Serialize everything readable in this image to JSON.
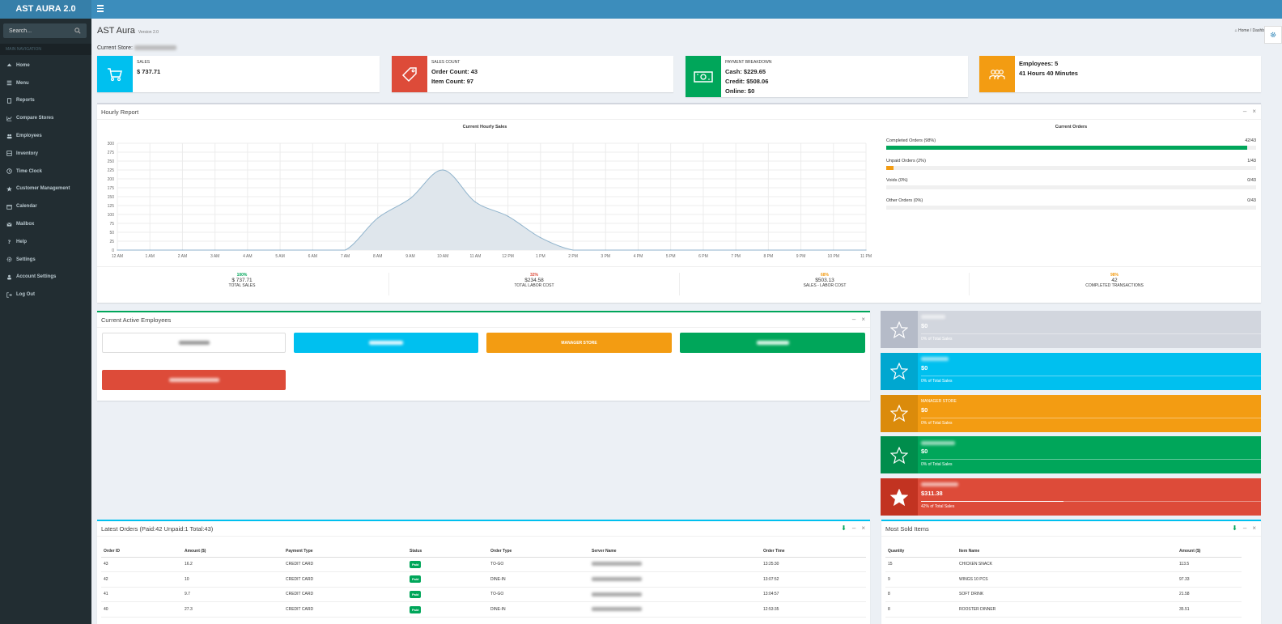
{
  "app": {
    "logo": "AST AURA 2.0"
  },
  "sidebar": {
    "search_placeholder": "Search...",
    "header": "MAIN NAVIGATION",
    "items": [
      {
        "label": "Home",
        "icon": "dashboard-icon"
      },
      {
        "label": "Menu",
        "icon": "menu-list-icon"
      },
      {
        "label": "Reports",
        "icon": "reports-icon"
      },
      {
        "label": "Compare Stores",
        "icon": "chart-icon"
      },
      {
        "label": "Employees",
        "icon": "users-icon"
      },
      {
        "label": "Inventory",
        "icon": "inventory-icon"
      },
      {
        "label": "Time Clock",
        "icon": "clock-icon"
      },
      {
        "label": "Customer Management",
        "icon": "star-icon"
      },
      {
        "label": "Calendar",
        "icon": "calendar-icon"
      },
      {
        "label": "Mailbox",
        "icon": "envelope-icon"
      },
      {
        "label": "Help",
        "icon": "question-icon"
      },
      {
        "label": "Settings",
        "icon": "gear-icon"
      },
      {
        "label": "Account Settings",
        "icon": "user-icon"
      },
      {
        "label": "Log Out",
        "icon": "logout-icon"
      }
    ]
  },
  "header": {
    "title": "AST Aura",
    "version": "Version 2.0",
    "breadcrumb_home": "Home",
    "breadcrumb_current": "Dashb",
    "current_store_label": "Current Store:"
  },
  "info_boxes": {
    "sales": {
      "label": "SALES",
      "value": "$ 737.71"
    },
    "sales_count": {
      "label": "SALES COUNT",
      "order_count": "Order Count: 43",
      "item_count": "Item Count: 97"
    },
    "payment": {
      "label": "PAYMENT BREAKDOWN",
      "cash": "Cash: $229.65",
      "credit": "Credit: $508.06",
      "online": "Online: $0"
    },
    "employees": {
      "count": "Employees: 5",
      "hours": "41 Hours 40 Minutes"
    }
  },
  "hourly_report": {
    "title": "Hourly Report",
    "chart_title": "Current Hourly Sales",
    "orders_title": "Current Orders",
    "progress": [
      {
        "label": "Completed Orders (98%)",
        "value": "42/43",
        "fraction": 0.977,
        "color": "#00a65a"
      },
      {
        "label": "Unpaid Orders (2%)",
        "value": "1/43",
        "fraction": 0.02,
        "color": "#f39c12"
      },
      {
        "label": "Voids (0%)",
        "value": "0/43",
        "fraction": 0,
        "color": "#dd4b39"
      },
      {
        "label": "Other Orders (0%)",
        "value": "0/43",
        "fraction": 0,
        "color": "#00c0ef"
      }
    ],
    "stats": [
      {
        "pct": "100%",
        "pct_color": "#00a65a",
        "value": "$ 737.71",
        "label": "TOTAL SALES"
      },
      {
        "pct": "32%",
        "pct_color": "#dd4b39",
        "value": "$234.58",
        "label": "TOTAL LABOR COST"
      },
      {
        "pct": "68%",
        "pct_color": "#f39c12",
        "value": "$503.13",
        "label": "SALES - LABOR COST"
      },
      {
        "pct": "98%",
        "pct_color": "#f39c12",
        "value": "42",
        "label": "COMPLETED TRANSACTIONS"
      }
    ]
  },
  "chart_data": {
    "type": "area",
    "title": "Current Hourly Sales",
    "x": [
      "12 AM",
      "1 AM",
      "2 AM",
      "3 AM",
      "4 AM",
      "5 AM",
      "6 AM",
      "7 AM",
      "8 AM",
      "9 AM",
      "10 AM",
      "11 AM",
      "12 PM",
      "1 PM",
      "2 PM",
      "3 PM",
      "4 PM",
      "5 PM",
      "6 PM",
      "7 PM",
      "8 PM",
      "9 PM",
      "10 PM",
      "11 PM"
    ],
    "series": [
      {
        "values": [
          0,
          0,
          0,
          0,
          0,
          0,
          0,
          0,
          90,
          145,
          225,
          135,
          95,
          35,
          0,
          0,
          0,
          0,
          0,
          0,
          0,
          0,
          0,
          0
        ]
      }
    ],
    "yticks": [
      0,
      25,
      50,
      75,
      100,
      125,
      150,
      175,
      200,
      225,
      250,
      275,
      300
    ],
    "ylim": [
      0,
      300
    ],
    "grid": true,
    "fill_color": "#dfe6ec",
    "line_color": "#8fb3cc"
  },
  "active_employees": {
    "title": "Current Active Employees",
    "manager_label": "MANAGER STORE"
  },
  "employee_sales": [
    {
      "value": "$0",
      "pct": "0% of Total Sales",
      "color": "#d2d6de",
      "dark": "#b5bbc8",
      "filled": false,
      "bar": 0
    },
    {
      "value": "$0",
      "pct": "0% of Total Sales",
      "color": "#00c0ef",
      "dark": "#00a7d0",
      "filled": false,
      "bar": 0
    },
    {
      "name": "MANAGER STORE",
      "value": "$0",
      "pct": "0% of Total Sales",
      "color": "#f39c12",
      "dark": "#db8b0b",
      "filled": false,
      "bar": 0
    },
    {
      "value": "$0",
      "pct": "0% of Total Sales",
      "color": "#00a65a",
      "dark": "#008d4c",
      "filled": false,
      "bar": 0
    },
    {
      "value": "$311.38",
      "pct": "42% of Total Sales",
      "color": "#dd4b39",
      "dark": "#c23321",
      "filled": true,
      "bar": 0.42
    }
  ],
  "latest_orders": {
    "title": "Latest Orders (Paid:42 Unpaid:1 Total:43)",
    "columns": [
      "Order ID",
      "Amount ($)",
      "Payment Type",
      "Status",
      "Order Type",
      "Server Name",
      "Order Time"
    ],
    "rows": [
      {
        "id": "43",
        "amount": "16.2",
        "payment": "CREDIT CARD",
        "status": "Paid",
        "type": "TO-GO",
        "time": "13:25:30"
      },
      {
        "id": "42",
        "amount": "10",
        "payment": "CREDIT CARD",
        "status": "Paid",
        "type": "DINE-IN",
        "time": "13:07:52"
      },
      {
        "id": "41",
        "amount": "9.7",
        "payment": "CREDIT CARD",
        "status": "Paid",
        "type": "TO-GO",
        "time": "13:04:57"
      },
      {
        "id": "40",
        "amount": "27.3",
        "payment": "CREDIT CARD",
        "status": "Paid",
        "type": "DINE-IN",
        "time": "12:53:35"
      }
    ]
  },
  "most_sold": {
    "title": "Most Sold Items",
    "columns": [
      "Quantity",
      "Item Name",
      "Amount ($)"
    ],
    "rows": [
      {
        "qty": "15",
        "name": "CHICKEN SNACK",
        "amount": "113.5"
      },
      {
        "qty": "9",
        "name": "WINGS 10 PCS",
        "amount": "97.33"
      },
      {
        "qty": "8",
        "name": "SOFT DRINK",
        "amount": "21.58"
      },
      {
        "qty": "8",
        "name": "ROOSTER DINNER",
        "amount": "35.51"
      }
    ]
  }
}
